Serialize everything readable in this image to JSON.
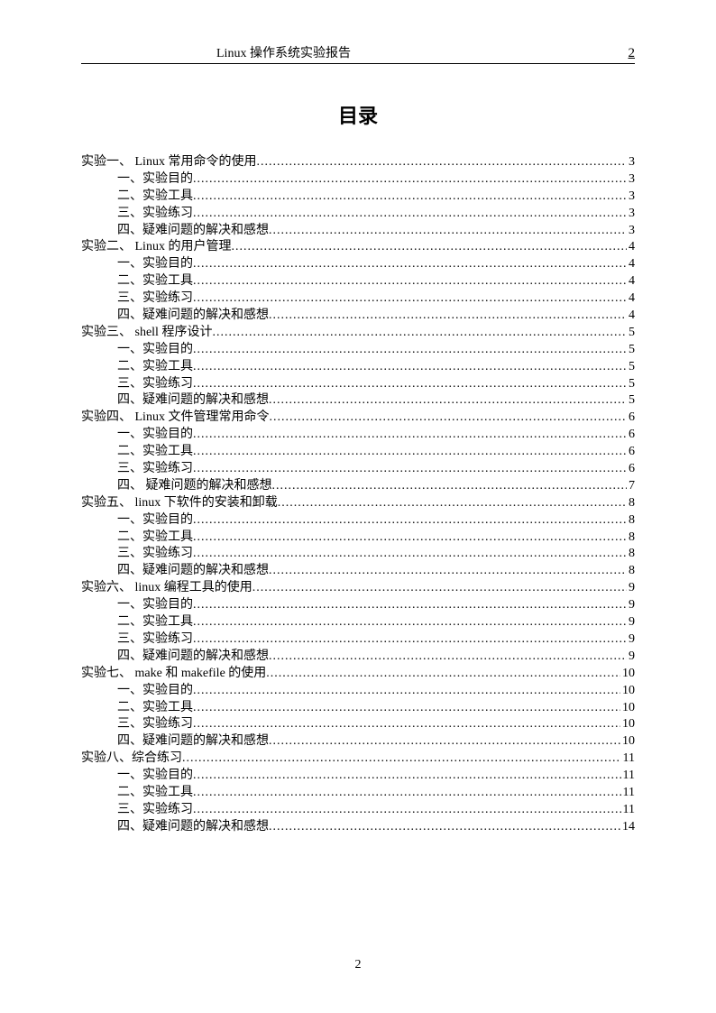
{
  "header": {
    "title": "Linux 操作系统实验报告",
    "page": "2"
  },
  "toc_title": "目录",
  "footer_page": "2",
  "toc": [
    {
      "level": 0,
      "label": "实验一、  Linux 常用命令的使用",
      "page": "3"
    },
    {
      "level": 1,
      "label": "一、实验目的",
      "page": "3"
    },
    {
      "level": 1,
      "label": "二、实验工具",
      "page": "3"
    },
    {
      "level": 1,
      "label": "三、实验练习",
      "page": "3"
    },
    {
      "level": 1,
      "label": "四、疑难问题的解决和感想",
      "page": "3"
    },
    {
      "level": 0,
      "label": "实验二、  Linux 的用户管理",
      "page": "4"
    },
    {
      "level": 1,
      "label": "一、实验目的",
      "page": "4"
    },
    {
      "level": 1,
      "label": "二、实验工具",
      "page": "4"
    },
    {
      "level": 1,
      "label": "三、实验练习",
      "page": "4"
    },
    {
      "level": 1,
      "label": "四、疑难问题的解决和感想",
      "page": "4"
    },
    {
      "level": 0,
      "label": "实验三、  shell 程序设计",
      "page": "5"
    },
    {
      "level": 1,
      "label": "一、实验目的",
      "page": "5"
    },
    {
      "level": 1,
      "label": "二、实验工具",
      "page": "5"
    },
    {
      "level": 1,
      "label": "三、实验练习",
      "page": "5"
    },
    {
      "level": 1,
      "label": "四、疑难问题的解决和感想",
      "page": "5"
    },
    {
      "level": 0,
      "label": "实验四、  Linux 文件管理常用命令",
      "page": "6"
    },
    {
      "level": 1,
      "label": "一、实验目的",
      "page": "6"
    },
    {
      "level": 1,
      "label": "二、实验工具",
      "page": "6"
    },
    {
      "level": 1,
      "label": "三、实验练习",
      "page": "6"
    },
    {
      "level": 1,
      "label": "四、 疑难问题的解决和感想",
      "page": "7"
    },
    {
      "level": 0,
      "label": "实验五、  linux 下软件的安装和卸载",
      "page": "8"
    },
    {
      "level": 1,
      "label": "一、实验目的",
      "page": "8"
    },
    {
      "level": 1,
      "label": "二、实验工具",
      "page": "8"
    },
    {
      "level": 1,
      "label": "三、实验练习",
      "page": "8"
    },
    {
      "level": 1,
      "label": "四、疑难问题的解决和感想",
      "page": "8"
    },
    {
      "level": 0,
      "label": "实验六、  linux 编程工具的使用",
      "page": "9"
    },
    {
      "level": 1,
      "label": "一、实验目的",
      "page": "9"
    },
    {
      "level": 1,
      "label": "二、实验工具",
      "page": "9"
    },
    {
      "level": 1,
      "label": "三、实验练习",
      "page": "9"
    },
    {
      "level": 1,
      "label": "四、疑难问题的解决和感想",
      "page": "9"
    },
    {
      "level": 0,
      "label": "实验七、  make 和 makefile 的使用",
      "page": "10"
    },
    {
      "level": 1,
      "label": "一、实验目的",
      "page": "10"
    },
    {
      "level": 1,
      "label": "二、实验工具",
      "page": "10"
    },
    {
      "level": 1,
      "label": "三、实验练习",
      "page": "10"
    },
    {
      "level": 1,
      "label": "四、疑难问题的解决和感想",
      "page": "10"
    },
    {
      "level": 0,
      "label": "实验八、综合练习",
      "page": "11"
    },
    {
      "level": 1,
      "label": "一、实验目的",
      "page": "11"
    },
    {
      "level": 1,
      "label": "二、实验工具",
      "page": "11"
    },
    {
      "level": 1,
      "label": "三、实验练习",
      "page": "11"
    },
    {
      "level": 1,
      "label": "四、疑难问题的解决和感想",
      "page": "14"
    }
  ]
}
